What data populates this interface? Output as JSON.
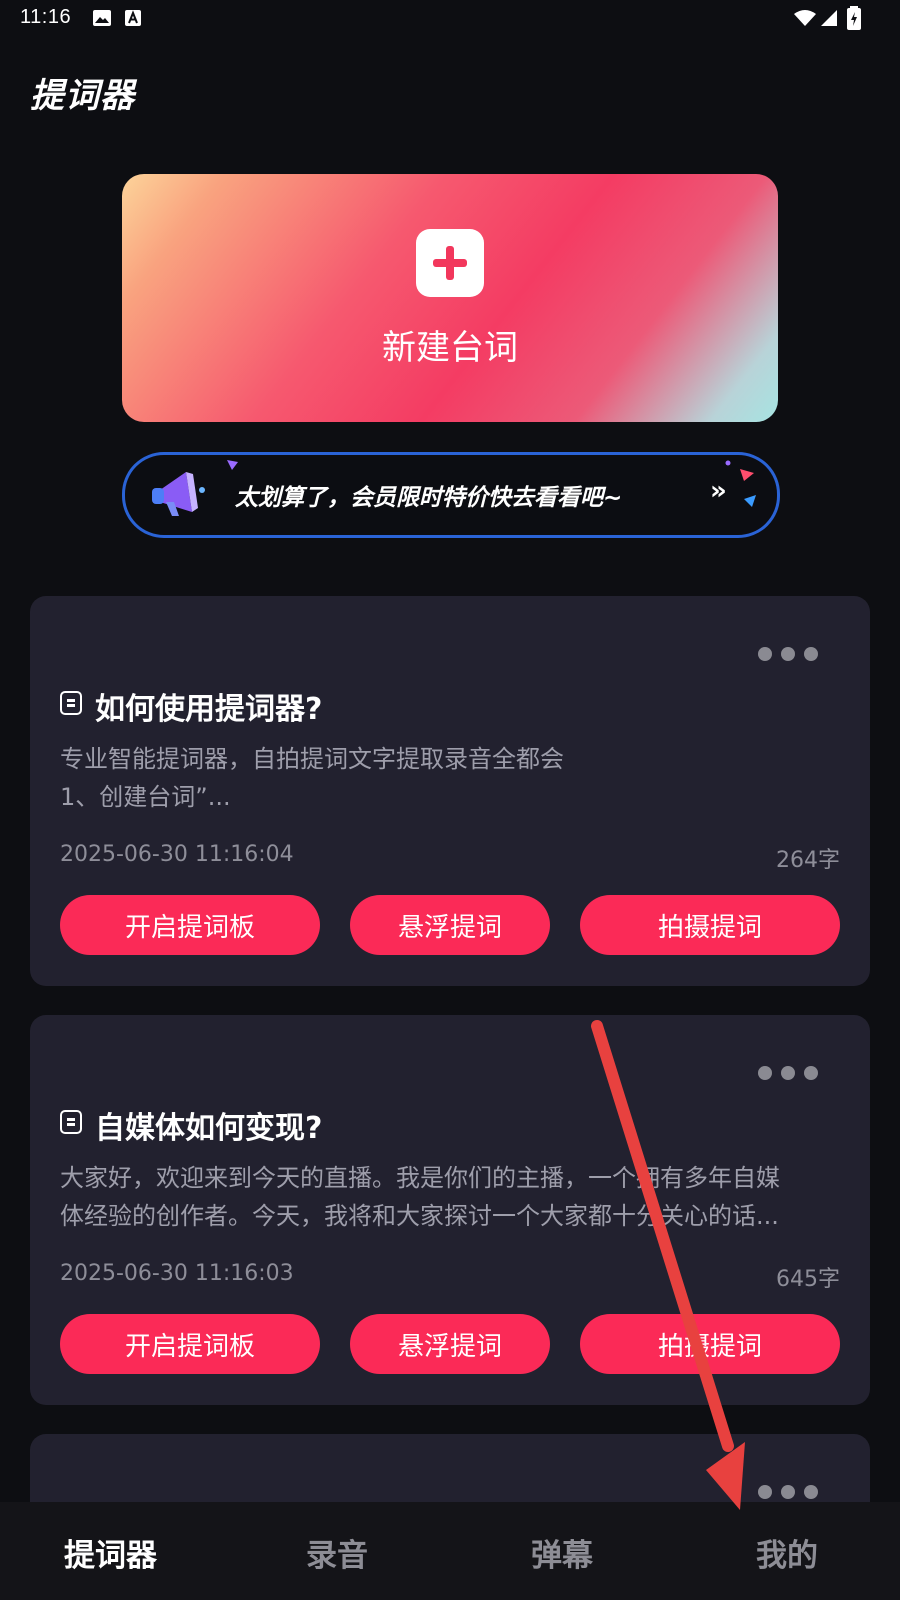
{
  "status_bar": {
    "time": "11:16"
  },
  "app": {
    "title": "提词器"
  },
  "new_script": {
    "label": "新建台词"
  },
  "promo": {
    "text": "太划算了，会员限时特价快去看看吧~",
    "arrow": "»"
  },
  "cards": [
    {
      "title": "如何使用提词器?",
      "lines": [
        "专业智能提词器，自拍提词文字提取录音全都会",
        "1、创建台词”..."
      ],
      "date": "2025-06-30 11:16:04",
      "count": "264字",
      "buttons": [
        "开启提词板",
        "悬浮提词",
        "拍摄提词"
      ]
    },
    {
      "title": "自媒体如何变现?",
      "lines": [
        "大家好，欢迎来到今天的直播。我是你们的主播，一个拥有多年自媒",
        "体经验的创作者。今天，我将和大家探讨一个大家都十分关心的话..."
      ],
      "date": "2025-06-30 11:16:03",
      "count": "645字",
      "buttons": [
        "开启提词板",
        "悬浮提词",
        "拍摄提词"
      ]
    }
  ],
  "tabs": [
    "提词器",
    "录音",
    "弹幕",
    "我的"
  ],
  "colors": {
    "accent": "#fb2a57",
    "card_bg": "#22212f",
    "page_bg": "#0d0e12",
    "annotation": "#e8413f"
  }
}
